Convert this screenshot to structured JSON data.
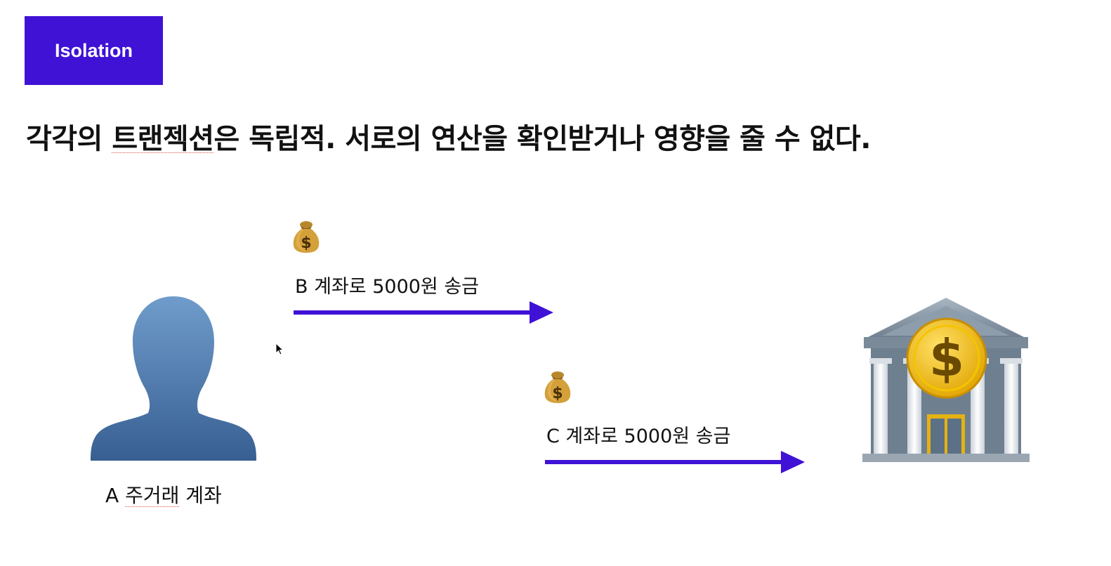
{
  "badge": {
    "label": "Isolation",
    "color": "#3f12d6"
  },
  "headline": {
    "part1": "각각의 ",
    "part2": "트랜젝션",
    "part3": "은 독립적. 서로의 연산을 확인받거나 영향을 줄 수 없다."
  },
  "transactions": [
    {
      "icon": "money-bag-icon",
      "label": "B 계좌로 5000원 송금"
    },
    {
      "icon": "money-bag-icon",
      "label": "C 계좌로 5000원 송금"
    }
  ],
  "source_account": {
    "icon": "person-silhouette-icon",
    "label_prefix": "A ",
    "label_underlined": "주거래",
    "label_suffix": " 계좌"
  },
  "destination": {
    "icon": "bank-icon"
  },
  "colors": {
    "arrow": "#3f12d6",
    "text": "#111111"
  }
}
